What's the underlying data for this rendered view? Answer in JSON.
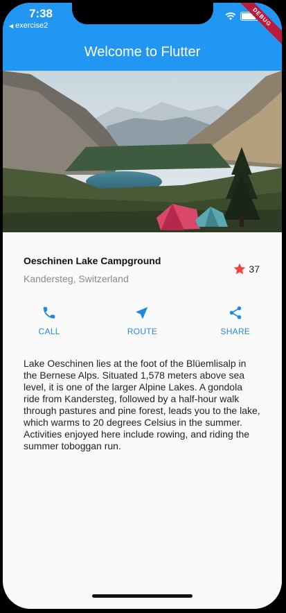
{
  "status_bar": {
    "time": "7:38",
    "back_app": "exercise2",
    "debug_banner": "DEBUG"
  },
  "app_bar": {
    "title": "Welcome to Flutter"
  },
  "campground": {
    "name": "Oeschinen Lake Campground",
    "location": "Kandersteg, Switzerland",
    "rating": "37"
  },
  "actions": [
    {
      "label": "CALL",
      "icon": "phone-icon"
    },
    {
      "label": "ROUTE",
      "icon": "navigation-icon"
    },
    {
      "label": "SHARE",
      "icon": "share-icon"
    }
  ],
  "description": "Lake Oeschinen lies at the foot of the Blüemlisalp in the Bernese Alps. Situated 1,578 meters above sea level, it is one of the larger Alpine Lakes. A gondola ride from Kandersteg, followed by a half-hour walk through pastures and pine forest, leads you to the lake, which warms to 20 degrees Celsius in the summer. Activities enjoyed here include rowing, and riding the summer toboggan run.",
  "colors": {
    "primary": "#2196f3",
    "accent_button": "#1e88e5",
    "star": "#f44336"
  }
}
